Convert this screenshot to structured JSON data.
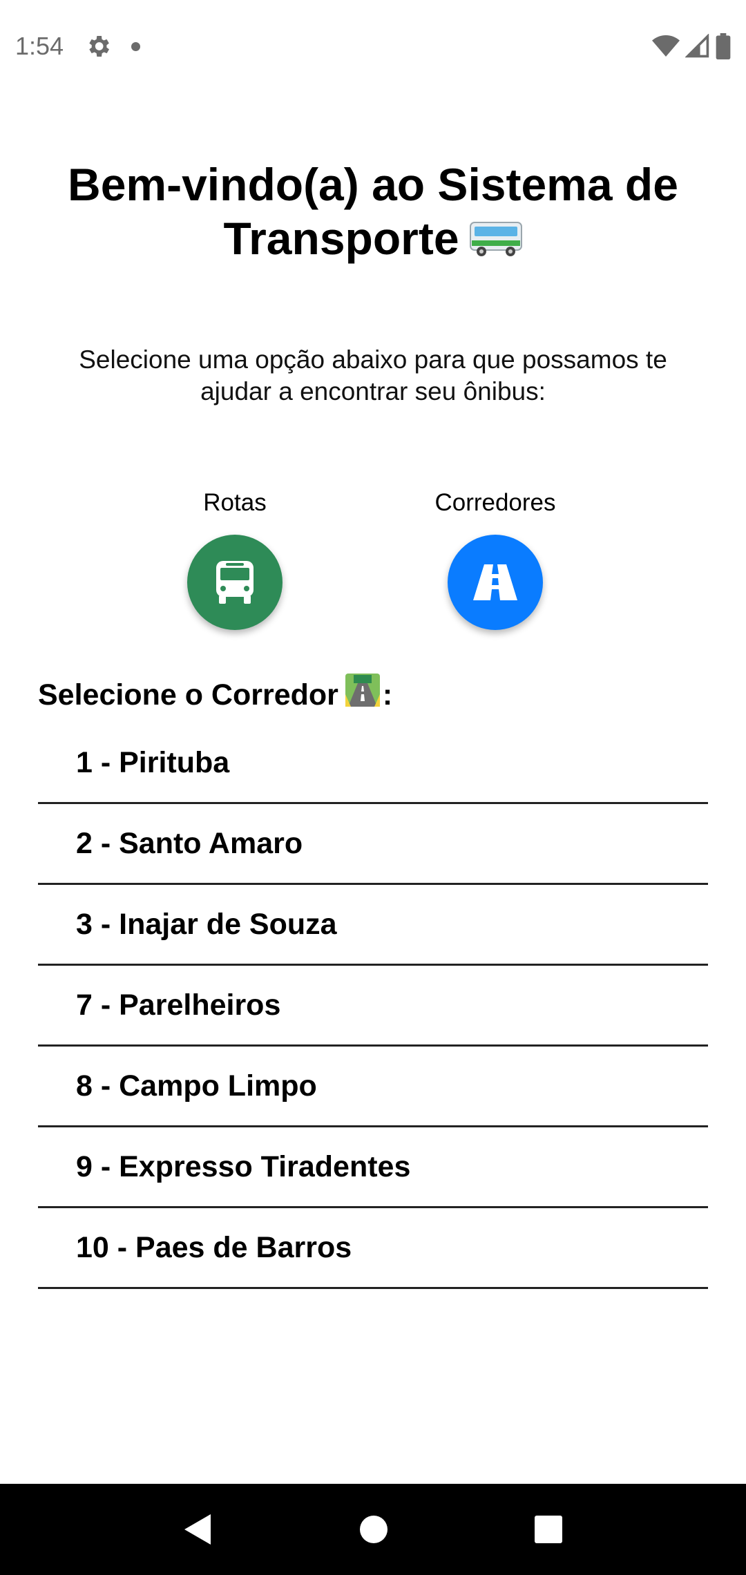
{
  "status_bar": {
    "time": "1:54",
    "icons": [
      "gear-icon",
      "notification-dot",
      "wifi-icon",
      "signal-icon",
      "battery-icon"
    ]
  },
  "header": {
    "title": "Bem-vindo(a) ao Sistema de Transporte",
    "title_emoji": "bus-icon"
  },
  "subtitle": "Selecione uma opção abaixo para que possamos te ajudar a encontrar seu ônibus:",
  "options": [
    {
      "label": "Rotas",
      "icon": "bus-front-icon",
      "color": "#2e8b57"
    },
    {
      "label": "Corredores",
      "icon": "road-icon",
      "color": "#0a7cff"
    }
  ],
  "corridor_section": {
    "heading": "Selecione o Corredor",
    "heading_suffix": ":",
    "heading_emoji": "motorway-icon",
    "items": [
      {
        "label": "1 - Pirituba"
      },
      {
        "label": "2 - Santo Amaro"
      },
      {
        "label": "3 - Inajar de Souza"
      },
      {
        "label": "7 - Parelheiros"
      },
      {
        "label": "8 - Campo Limpo"
      },
      {
        "label": "9 - Expresso Tiradentes"
      },
      {
        "label": "10 - Paes de Barros"
      }
    ]
  },
  "nav_bar": {
    "buttons": [
      "back-icon",
      "home-icon",
      "recents-icon"
    ]
  }
}
